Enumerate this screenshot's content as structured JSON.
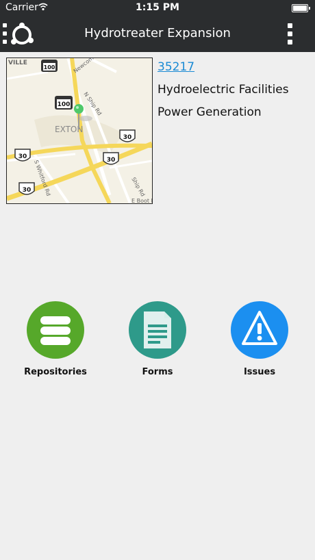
{
  "status_bar": {
    "carrier": "Carrier",
    "time": "1:15 PM"
  },
  "nav": {
    "title": "Hydrotreater Expansion"
  },
  "asset": {
    "id": "35217",
    "line1": "Hydroelectric Facilities",
    "line2": "Power Generation"
  },
  "map": {
    "town_label": "EXTON",
    "corner_label": "VILLE",
    "street_labels": [
      "Newcomen Rd",
      "N Ship Rd",
      "S Whitford Rd",
      "Ship Rd",
      "E Boot Rd"
    ],
    "route_100_label": "100",
    "route_30_label": "30"
  },
  "actions": [
    {
      "label": "Repositories",
      "icon": "database-icon",
      "color": "#56a82a"
    },
    {
      "label": "Forms",
      "icon": "form-document-icon",
      "color": "#2e9a8a"
    },
    {
      "label": "Issues",
      "icon": "warning-icon",
      "color": "#1b8ff0"
    }
  ],
  "colors": {
    "nav_background": "#2b2d2f",
    "link": "#1a8ad4",
    "page_background": "#efefef"
  }
}
